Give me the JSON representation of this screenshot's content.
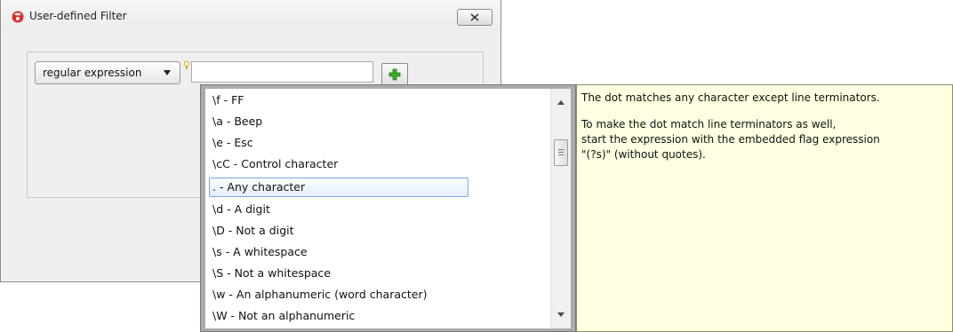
{
  "dialog": {
    "title": "User-defined Filter",
    "icon": "app-logo-icon",
    "close_icon": "close-icon"
  },
  "filter": {
    "type_selected": "regular expression",
    "input_value": "",
    "add_icon": "plus-icon"
  },
  "autocomplete": {
    "items": [
      "\\f - FF",
      "\\a - Beep",
      "\\e - Esc",
      "\\cC - Control character",
      ". - Any character",
      "\\d - A digit",
      "\\D - Not a digit",
      "\\s - A whitespace",
      "\\S - Not a whitespace",
      "\\w - An alphanumeric (word character)",
      "\\W - Not an alphanumeric"
    ],
    "selected_index": 4
  },
  "tooltip": {
    "line1": "The dot matches any character except line terminators.",
    "line2": "To make the dot match line terminators as well,",
    "line3": "start the expression with the embedded flag expression",
    "line4": "\"(?s)\" (without quotes)."
  },
  "colors": {
    "tooltip_bg": "#ffffe1",
    "selection_border": "#7aa7e0",
    "plus_green": "#3daa2c",
    "logo_red": "#d9322a"
  }
}
